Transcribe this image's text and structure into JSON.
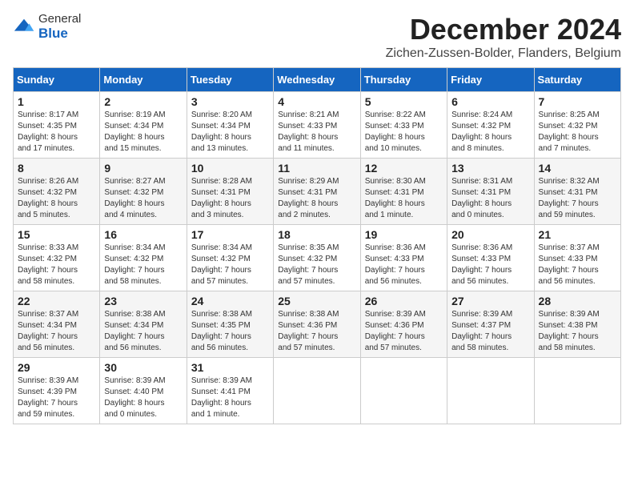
{
  "logo": {
    "general": "General",
    "blue": "Blue"
  },
  "title": {
    "month": "December 2024",
    "location": "Zichen-Zussen-Bolder, Flanders, Belgium"
  },
  "headers": [
    "Sunday",
    "Monday",
    "Tuesday",
    "Wednesday",
    "Thursday",
    "Friday",
    "Saturday"
  ],
  "weeks": [
    [
      {
        "day": "1",
        "info": "Sunrise: 8:17 AM\nSunset: 4:35 PM\nDaylight: 8 hours\nand 17 minutes."
      },
      {
        "day": "2",
        "info": "Sunrise: 8:19 AM\nSunset: 4:34 PM\nDaylight: 8 hours\nand 15 minutes."
      },
      {
        "day": "3",
        "info": "Sunrise: 8:20 AM\nSunset: 4:34 PM\nDaylight: 8 hours\nand 13 minutes."
      },
      {
        "day": "4",
        "info": "Sunrise: 8:21 AM\nSunset: 4:33 PM\nDaylight: 8 hours\nand 11 minutes."
      },
      {
        "day": "5",
        "info": "Sunrise: 8:22 AM\nSunset: 4:33 PM\nDaylight: 8 hours\nand 10 minutes."
      },
      {
        "day": "6",
        "info": "Sunrise: 8:24 AM\nSunset: 4:32 PM\nDaylight: 8 hours\nand 8 minutes."
      },
      {
        "day": "7",
        "info": "Sunrise: 8:25 AM\nSunset: 4:32 PM\nDaylight: 8 hours\nand 7 minutes."
      }
    ],
    [
      {
        "day": "8",
        "info": "Sunrise: 8:26 AM\nSunset: 4:32 PM\nDaylight: 8 hours\nand 5 minutes."
      },
      {
        "day": "9",
        "info": "Sunrise: 8:27 AM\nSunset: 4:32 PM\nDaylight: 8 hours\nand 4 minutes."
      },
      {
        "day": "10",
        "info": "Sunrise: 8:28 AM\nSunset: 4:31 PM\nDaylight: 8 hours\nand 3 minutes."
      },
      {
        "day": "11",
        "info": "Sunrise: 8:29 AM\nSunset: 4:31 PM\nDaylight: 8 hours\nand 2 minutes."
      },
      {
        "day": "12",
        "info": "Sunrise: 8:30 AM\nSunset: 4:31 PM\nDaylight: 8 hours\nand 1 minute."
      },
      {
        "day": "13",
        "info": "Sunrise: 8:31 AM\nSunset: 4:31 PM\nDaylight: 8 hours\nand 0 minutes."
      },
      {
        "day": "14",
        "info": "Sunrise: 8:32 AM\nSunset: 4:31 PM\nDaylight: 7 hours\nand 59 minutes."
      }
    ],
    [
      {
        "day": "15",
        "info": "Sunrise: 8:33 AM\nSunset: 4:32 PM\nDaylight: 7 hours\nand 58 minutes."
      },
      {
        "day": "16",
        "info": "Sunrise: 8:34 AM\nSunset: 4:32 PM\nDaylight: 7 hours\nand 58 minutes."
      },
      {
        "day": "17",
        "info": "Sunrise: 8:34 AM\nSunset: 4:32 PM\nDaylight: 7 hours\nand 57 minutes."
      },
      {
        "day": "18",
        "info": "Sunrise: 8:35 AM\nSunset: 4:32 PM\nDaylight: 7 hours\nand 57 minutes."
      },
      {
        "day": "19",
        "info": "Sunrise: 8:36 AM\nSunset: 4:33 PM\nDaylight: 7 hours\nand 56 minutes."
      },
      {
        "day": "20",
        "info": "Sunrise: 8:36 AM\nSunset: 4:33 PM\nDaylight: 7 hours\nand 56 minutes."
      },
      {
        "day": "21",
        "info": "Sunrise: 8:37 AM\nSunset: 4:33 PM\nDaylight: 7 hours\nand 56 minutes."
      }
    ],
    [
      {
        "day": "22",
        "info": "Sunrise: 8:37 AM\nSunset: 4:34 PM\nDaylight: 7 hours\nand 56 minutes."
      },
      {
        "day": "23",
        "info": "Sunrise: 8:38 AM\nSunset: 4:34 PM\nDaylight: 7 hours\nand 56 minutes."
      },
      {
        "day": "24",
        "info": "Sunrise: 8:38 AM\nSunset: 4:35 PM\nDaylight: 7 hours\nand 56 minutes."
      },
      {
        "day": "25",
        "info": "Sunrise: 8:38 AM\nSunset: 4:36 PM\nDaylight: 7 hours\nand 57 minutes."
      },
      {
        "day": "26",
        "info": "Sunrise: 8:39 AM\nSunset: 4:36 PM\nDaylight: 7 hours\nand 57 minutes."
      },
      {
        "day": "27",
        "info": "Sunrise: 8:39 AM\nSunset: 4:37 PM\nDaylight: 7 hours\nand 58 minutes."
      },
      {
        "day": "28",
        "info": "Sunrise: 8:39 AM\nSunset: 4:38 PM\nDaylight: 7 hours\nand 58 minutes."
      }
    ],
    [
      {
        "day": "29",
        "info": "Sunrise: 8:39 AM\nSunset: 4:39 PM\nDaylight: 7 hours\nand 59 minutes."
      },
      {
        "day": "30",
        "info": "Sunrise: 8:39 AM\nSunset: 4:40 PM\nDaylight: 8 hours\nand 0 minutes."
      },
      {
        "day": "31",
        "info": "Sunrise: 8:39 AM\nSunset: 4:41 PM\nDaylight: 8 hours\nand 1 minute."
      },
      null,
      null,
      null,
      null
    ]
  ]
}
